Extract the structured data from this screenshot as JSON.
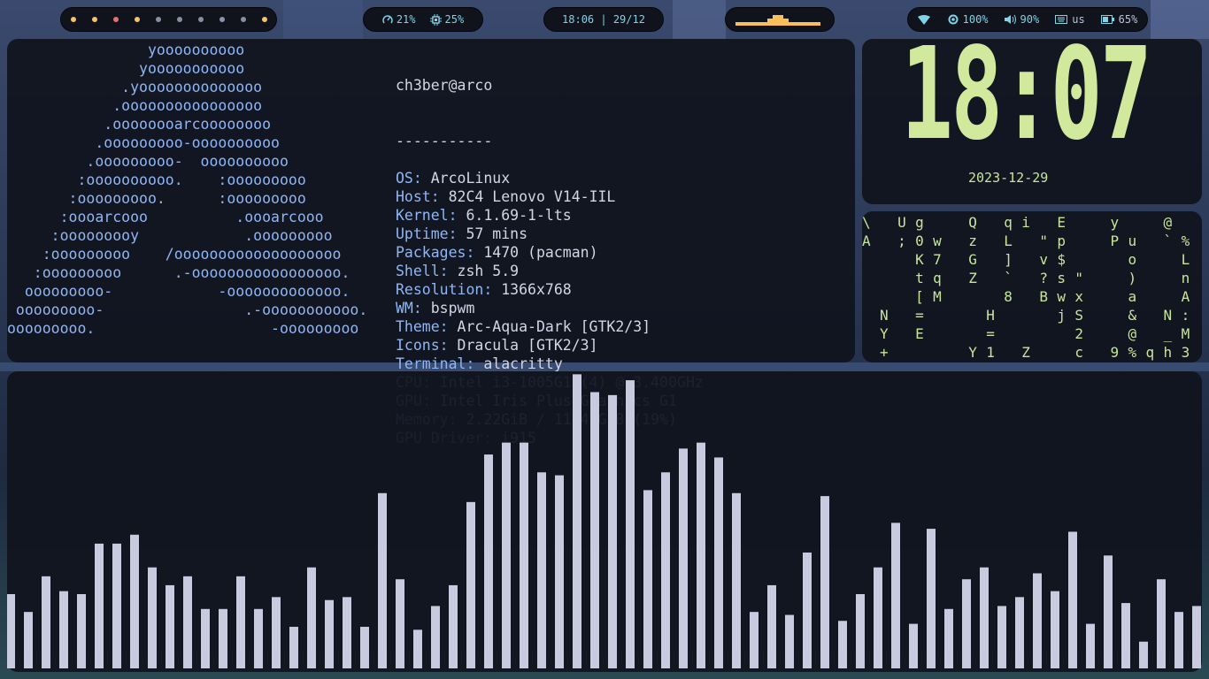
{
  "topbar": {
    "workspaces": [
      "#f6c26b",
      "#f6c26b",
      "#e76f76",
      "#f6c26b",
      "#8a8fa3",
      "#8a8fa3",
      "#8a8fa3",
      "#8a94ad",
      "#8a8fa3",
      "#f6c26b"
    ],
    "cpu": {
      "icon": "gauge-icon",
      "value": "21%"
    },
    "memory": {
      "icon": "chip-icon",
      "value": "25%"
    },
    "clock": "18:06 | 29/12",
    "mini_visualizer_color": "#fbbf5a",
    "mini_visualizer_levels": [
      1,
      1,
      1,
      1,
      1,
      1,
      2,
      3,
      3,
      2,
      1,
      1,
      1,
      1,
      1,
      1
    ],
    "wifi": {
      "icon": "wifi-icon"
    },
    "brightness": {
      "icon": "brightness-icon",
      "value": "100%"
    },
    "volume": {
      "icon": "volume-icon",
      "value": "90%"
    },
    "keyboard": {
      "icon": "keyboard-icon",
      "value": "us"
    },
    "battery": {
      "icon": "battery-icon",
      "value": "65%"
    },
    "accent": "#7fd3e6"
  },
  "neofetch": {
    "ascii_art": [
      "                yoooooooooo",
      "               yooooooooooo",
      "             .yoooooooooooooo",
      "            .oooooooooooooooo",
      "           .oooooooarcoooooooo",
      "          .ooooooooo-oooooooooo",
      "         .ooooooooo-  oooooooooo",
      "        :oooooooooo.    :ooooooooo",
      "       :ooooooooo.      :ooooooooo",
      "      :oooarcooo          .oooarcooo",
      "     :ooooooooy            .ooooooooo",
      "    :ooooooooo    /ooooooooooooooooooo",
      "   :ooooooooo      .-ooooooooooooooooo.",
      "  ooooooooo-            -ooooooooooooo.",
      " ooooooooo-                .-ooooooooooo.",
      "ooooooooo.                    -ooooooooo"
    ],
    "title": "ch3ber@arco",
    "separator": "-----------",
    "fields": [
      {
        "key": "OS",
        "value": "ArcoLinux"
      },
      {
        "key": "Host",
        "value": "82C4 Lenovo V14-IIL"
      },
      {
        "key": "Kernel",
        "value": "6.1.69-1-lts"
      },
      {
        "key": "Uptime",
        "value": "57 mins"
      },
      {
        "key": "Packages",
        "value": "1470 (pacman)"
      },
      {
        "key": "Shell",
        "value": "zsh 5.9"
      },
      {
        "key": "Resolution",
        "value": "1366x768"
      },
      {
        "key": "WM",
        "value": "bspwm"
      },
      {
        "key": "Theme",
        "value": "Arc-Aqua-Dark [GTK2/3]"
      },
      {
        "key": "Icons",
        "value": "Dracula [GTK2/3]"
      },
      {
        "key": "Terminal",
        "value": "alacritty"
      },
      {
        "key": "CPU",
        "value": "Intel i3-1005G1 (4) @ 3.400GHz"
      },
      {
        "key": "GPU",
        "value": "Intel Iris Plus Graphics G1"
      },
      {
        "key": "Memory",
        "value": "2.22GiB / 11.49GiB (19%)"
      },
      {
        "key": "GPU Driver",
        "value": "i915"
      }
    ]
  },
  "clock": {
    "time": "18:07",
    "date": "2023-12-29",
    "color": "#d0e99c"
  },
  "matrix_rows": [
    "\\ Ug  Q qi E  y  @ ",
    "A ;0w z L \"p  Pu `%",
    "   K7 G ] v$   o  L",
    "   tq Z ` ?s\"  )  n",
    "   [M   8 Bwx  a  A",
    " N =   H   jS  & N:",
    " Y E   =    2  @ _M",
    " +    Y1 Z  c 9%qh3"
  ],
  "visualizer": {
    "color": "#c8cae0",
    "levels_percent": [
      25,
      19,
      31,
      26,
      25,
      42,
      42,
      45,
      34,
      28,
      31,
      20,
      20,
      31,
      20,
      24,
      14,
      34,
      23,
      24,
      14,
      59,
      30,
      13,
      21,
      28,
      56,
      72,
      76,
      76,
      66,
      65,
      99,
      93,
      92,
      97,
      60,
      66,
      74,
      76,
      71,
      59,
      19,
      28,
      18,
      39,
      58,
      16,
      25,
      34,
      49,
      15,
      47,
      20,
      30,
      34,
      21,
      24,
      32,
      26,
      46,
      15,
      38,
      22,
      9,
      30,
      19,
      21
    ]
  }
}
